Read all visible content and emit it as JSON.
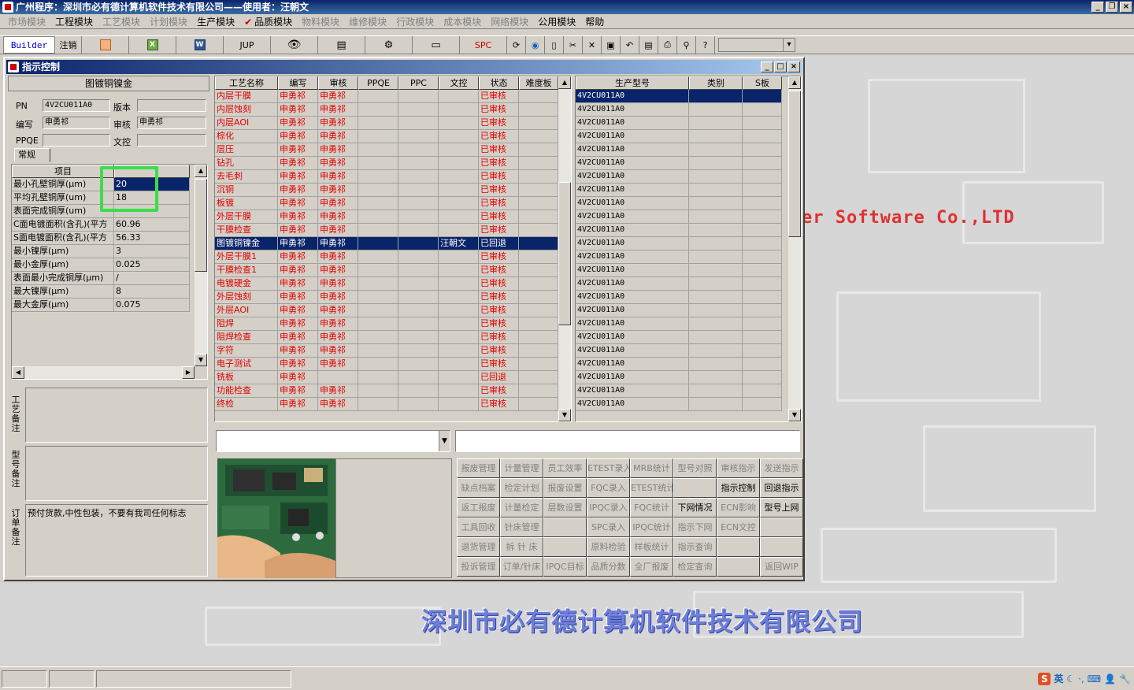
{
  "app": {
    "title": "广州程序：深圳市必有德计算机软件技术有限公司——使用者：汪朝文",
    "window_buttons": [
      "_",
      "❐",
      "×"
    ]
  },
  "menu": [
    {
      "label": "市场模块",
      "enabled": false
    },
    {
      "label": "工程模块",
      "enabled": true
    },
    {
      "label": "工艺模块",
      "enabled": false
    },
    {
      "label": "计划模块",
      "enabled": false
    },
    {
      "label": "生产模块",
      "enabled": true
    },
    {
      "label": "品质模块",
      "enabled": true,
      "checked": true
    },
    {
      "label": "物料模块",
      "enabled": false
    },
    {
      "label": "维修模块",
      "enabled": false
    },
    {
      "label": "行政模块",
      "enabled": false
    },
    {
      "label": "成本模块",
      "enabled": false
    },
    {
      "label": "网络模块",
      "enabled": false
    },
    {
      "label": "公用模块",
      "enabled": true
    },
    {
      "label": "帮助",
      "enabled": true
    }
  ],
  "toolbar": {
    "builder": "Builder",
    "logout": "注销",
    "jup": "JUP",
    "spc": "SPC"
  },
  "background": {
    "software_text": "er Software Co.,LTD",
    "company_text": "深圳市必有德计算机软件技术有限公司"
  },
  "child": {
    "title": "指示控制",
    "buttons": [
      "_",
      "□",
      "×"
    ]
  },
  "left": {
    "header": "图镀铜镍金",
    "pn_label": "PN",
    "pn_value": "4V2CU011A0",
    "version_label": "版本",
    "version_value": "",
    "author_label": "编写",
    "author_value": "申勇祁",
    "review_label": "审核",
    "review_value": "申勇祁",
    "ppqe_label": "PPQE",
    "ppqe_value": "",
    "wenkong_label": "文控",
    "wenkong_value": "",
    "tab": "常规",
    "param_header_item": "项目",
    "param_header_value": "",
    "params": [
      {
        "item": "最小孔壁铜厚(μm)",
        "value": "20"
      },
      {
        "item": "平均孔壁铜厚(um)",
        "value": "18"
      },
      {
        "item": "表面完成铜厚(um)",
        "value": ""
      },
      {
        "item": "C面电镀面积(含孔)(平方",
        "value": "60.96"
      },
      {
        "item": "S面电镀面积(含孔)(平方",
        "value": "56.33"
      },
      {
        "item": "最小镍厚(μm)",
        "value": "3"
      },
      {
        "item": "最小金厚(μm)",
        "value": "0.025"
      },
      {
        "item": "表面最小完成铜厚(μm)",
        "value": "/"
      },
      {
        "item": "最大镍厚(μm)",
        "value": "8"
      },
      {
        "item": "最大金厚(μm)",
        "value": "0.075"
      }
    ],
    "memo1_label": "工艺备注",
    "memo2_label": "型号备注",
    "memo3_label": "订单备注",
    "memo3_text": "预付货款,中性包装，不要有我司任何标志"
  },
  "process": {
    "headers": [
      "工艺名称",
      "编写",
      "审核",
      "PPQE",
      "PPC",
      "文控",
      "状态",
      "难度板"
    ],
    "rows": [
      [
        "内层干膜",
        "申勇祁",
        "申勇祁",
        "",
        "",
        "",
        "已审核",
        ""
      ],
      [
        "内层蚀刻",
        "申勇祁",
        "申勇祁",
        "",
        "",
        "",
        "已审核",
        ""
      ],
      [
        "内层AOI",
        "申勇祁",
        "申勇祁",
        "",
        "",
        "",
        "已审核",
        ""
      ],
      [
        "棕化",
        "申勇祁",
        "申勇祁",
        "",
        "",
        "",
        "已审核",
        ""
      ],
      [
        "层压",
        "申勇祁",
        "申勇祁",
        "",
        "",
        "",
        "已审核",
        ""
      ],
      [
        "钻孔",
        "申勇祁",
        "申勇祁",
        "",
        "",
        "",
        "已审核",
        ""
      ],
      [
        "去毛刺",
        "申勇祁",
        "申勇祁",
        "",
        "",
        "",
        "已审核",
        ""
      ],
      [
        "沉铜",
        "申勇祁",
        "申勇祁",
        "",
        "",
        "",
        "已审核",
        ""
      ],
      [
        "板镀",
        "申勇祁",
        "申勇祁",
        "",
        "",
        "",
        "已审核",
        ""
      ],
      [
        "外层干膜",
        "申勇祁",
        "申勇祁",
        "",
        "",
        "",
        "已审核",
        ""
      ],
      [
        "干膜检查",
        "申勇祁",
        "申勇祁",
        "",
        "",
        "",
        "已审核",
        ""
      ],
      [
        "图镀铜镍金",
        "申勇祁",
        "申勇祁",
        "",
        "",
        "汪朝文",
        "已回退",
        ""
      ],
      [
        "外层干膜1",
        "申勇祁",
        "申勇祁",
        "",
        "",
        "",
        "已审核",
        ""
      ],
      [
        "干膜检查1",
        "申勇祁",
        "申勇祁",
        "",
        "",
        "",
        "已审核",
        ""
      ],
      [
        "电镀硬金",
        "申勇祁",
        "申勇祁",
        "",
        "",
        "",
        "已审核",
        ""
      ],
      [
        "外层蚀刻",
        "申勇祁",
        "申勇祁",
        "",
        "",
        "",
        "已审核",
        ""
      ],
      [
        "外层AOI",
        "申勇祁",
        "申勇祁",
        "",
        "",
        "",
        "已审核",
        ""
      ],
      [
        "阻焊",
        "申勇祁",
        "申勇祁",
        "",
        "",
        "",
        "已审核",
        ""
      ],
      [
        "阻焊检查",
        "申勇祁",
        "申勇祁",
        "",
        "",
        "",
        "已审核",
        ""
      ],
      [
        "字符",
        "申勇祁",
        "申勇祁",
        "",
        "",
        "",
        "已审核",
        ""
      ],
      [
        "电子测试",
        "申勇祁",
        "申勇祁",
        "",
        "",
        "",
        "已审核",
        ""
      ],
      [
        "铣板",
        "申勇祁",
        "",
        "",
        "",
        "",
        "已回退",
        ""
      ],
      [
        "功能检查",
        "申勇祁",
        "申勇祁",
        "",
        "",
        "",
        "已审核",
        ""
      ],
      [
        "终检",
        "申勇祁",
        "申勇祁",
        "",
        "",
        "",
        "已审核",
        ""
      ]
    ],
    "selected_row": 11
  },
  "models": {
    "headers": [
      "生产型号",
      "类别",
      "S板"
    ],
    "rows": [
      "4V2CU011A0",
      "4V2CU011A0",
      "4V2CU011A0",
      "4V2CU011A0",
      "4V2CU011A0",
      "4V2CU011A0",
      "4V2CU011A0",
      "4V2CU011A0",
      "4V2CU011A0",
      "4V2CU011A0",
      "4V2CU011A0",
      "4V2CU011A0",
      "4V2CU011A0",
      "4V2CU011A0",
      "4V2CU011A0",
      "4V2CU011A0",
      "4V2CU011A0",
      "4V2CU011A0",
      "4V2CU011A0",
      "4V2CU011A0",
      "4V2CU011A0",
      "4V2CU011A0",
      "4V2CU011A0",
      "4V2CU011A0"
    ]
  },
  "actions": [
    {
      "label": "报废管理",
      "enabled": false
    },
    {
      "label": "计量管理",
      "enabled": false
    },
    {
      "label": "员工效率",
      "enabled": false
    },
    {
      "label": "ETEST录入",
      "enabled": false
    },
    {
      "label": "MRB统计",
      "enabled": false
    },
    {
      "label": "型号对照",
      "enabled": false
    },
    {
      "label": "审核指示",
      "enabled": false
    },
    {
      "label": "发送指示",
      "enabled": false
    },
    {
      "label": "缺点档案",
      "enabled": false
    },
    {
      "label": "检定计划",
      "enabled": false
    },
    {
      "label": "报废设置",
      "enabled": false
    },
    {
      "label": "FQC录入",
      "enabled": false
    },
    {
      "label": "ETEST统计",
      "enabled": false
    },
    {
      "label": "",
      "enabled": false
    },
    {
      "label": "指示控制",
      "enabled": true
    },
    {
      "label": "回退指示",
      "enabled": true
    },
    {
      "label": "返工报废",
      "enabled": false
    },
    {
      "label": "计量检定",
      "enabled": false
    },
    {
      "label": "层数设置",
      "enabled": false
    },
    {
      "label": "IPQC录入",
      "enabled": false
    },
    {
      "label": "FQC统计",
      "enabled": false
    },
    {
      "label": "下网情况",
      "enabled": true
    },
    {
      "label": "ECN影响",
      "enabled": false
    },
    {
      "label": "型号上网",
      "enabled": true
    },
    {
      "label": "工具回收",
      "enabled": false
    },
    {
      "label": "针床管理",
      "enabled": false
    },
    {
      "label": "",
      "enabled": false
    },
    {
      "label": "SPC录入",
      "enabled": false
    },
    {
      "label": "IPQC统计",
      "enabled": false
    },
    {
      "label": "指示下网",
      "enabled": false
    },
    {
      "label": "ECN文控",
      "enabled": false
    },
    {
      "label": "",
      "enabled": false
    },
    {
      "label": "退货管理",
      "enabled": false
    },
    {
      "label": "拆 针 床",
      "enabled": false
    },
    {
      "label": "",
      "enabled": false
    },
    {
      "label": "原料检验",
      "enabled": false
    },
    {
      "label": "样板统计",
      "enabled": false
    },
    {
      "label": "指示查询",
      "enabled": false
    },
    {
      "label": "",
      "enabled": false
    },
    {
      "label": "",
      "enabled": false
    },
    {
      "label": "投诉管理",
      "enabled": false
    },
    {
      "label": "订单/针床",
      "enabled": false
    },
    {
      "label": "IPQC目标",
      "enabled": false
    },
    {
      "label": "品质分数",
      "enabled": false
    },
    {
      "label": "全厂报废",
      "enabled": false
    },
    {
      "label": "检定查询",
      "enabled": false
    },
    {
      "label": "",
      "enabled": false
    },
    {
      "label": "返回WIP",
      "enabled": false
    }
  ],
  "tray": {
    "ime": "S",
    "lang": "英"
  },
  "colors": {
    "red_text": "#e00000",
    "selection": "#0a246a",
    "highlight": "#3ddc4a"
  }
}
